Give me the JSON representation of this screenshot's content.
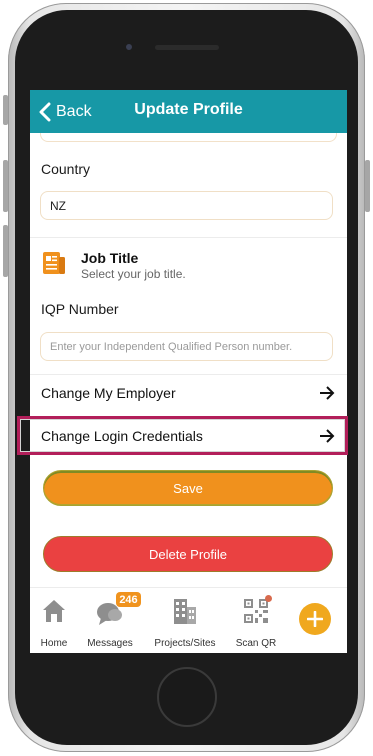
{
  "header": {
    "back_label": "Back",
    "title": "Update Profile"
  },
  "form": {
    "country_label": "Country",
    "country_value": "NZ",
    "job_title": {
      "title": "Job Title",
      "subtitle": "Select your job title.",
      "icon": "document-icon"
    },
    "iqp_label": "IQP Number",
    "iqp_placeholder": "Enter your Independent Qualified Person number.",
    "links": [
      {
        "label": "Change My Employer"
      },
      {
        "label": "Change Login Credentials"
      }
    ],
    "save_label": "Save",
    "delete_label": "Delete Profile"
  },
  "bottom_nav": {
    "items": [
      {
        "label": "Home",
        "icon": "home-icon"
      },
      {
        "label": "Messages",
        "icon": "messages-icon",
        "badge": "246"
      },
      {
        "label": "Projects/Sites",
        "icon": "buildings-icon"
      },
      {
        "label": "Scan QR",
        "icon": "qr-code-icon"
      }
    ],
    "fab_icon": "plus-icon"
  },
  "colors": {
    "header": "#1798a6",
    "accent_orange": "#f0911d",
    "danger_red": "#ea4141",
    "highlight": "#b21f5a"
  }
}
